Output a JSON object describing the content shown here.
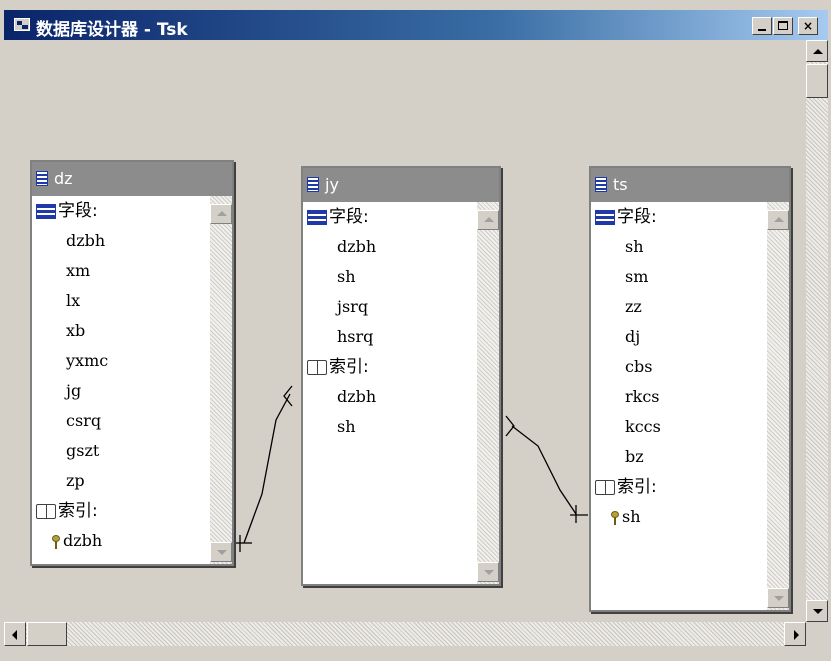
{
  "window": {
    "title": "数据库设计器 - Tsk",
    "min_label": "",
    "max_label": "",
    "close_label": "×"
  },
  "tables": [
    {
      "name": "dz",
      "fields_label": "字段:",
      "fields": [
        "dzbh",
        "xm",
        "lx",
        "xb",
        "yxmc",
        "jg",
        "csrq",
        "gszt",
        "zp"
      ],
      "index_label": "索引:",
      "indexes": [
        {
          "name": "dzbh",
          "primary": true
        }
      ]
    },
    {
      "name": "jy",
      "fields_label": "字段:",
      "fields": [
        "dzbh",
        "sh",
        "jsrq",
        "hsrq"
      ],
      "index_label": "索引:",
      "indexes": [
        {
          "name": "dzbh",
          "primary": false
        },
        {
          "name": "sh",
          "primary": false
        }
      ]
    },
    {
      "name": "ts",
      "fields_label": "字段:",
      "fields": [
        "sh",
        "sm",
        "zz",
        "dj",
        "cbs",
        "rkcs",
        "kccs",
        "bz"
      ],
      "index_label": "索引:",
      "indexes": [
        {
          "name": "sh",
          "primary": true
        }
      ]
    }
  ],
  "relations": [
    {
      "from": "dz.dzbh",
      "to": "jy.dzbh"
    },
    {
      "from": "ts.sh",
      "to": "jy.sh"
    }
  ]
}
